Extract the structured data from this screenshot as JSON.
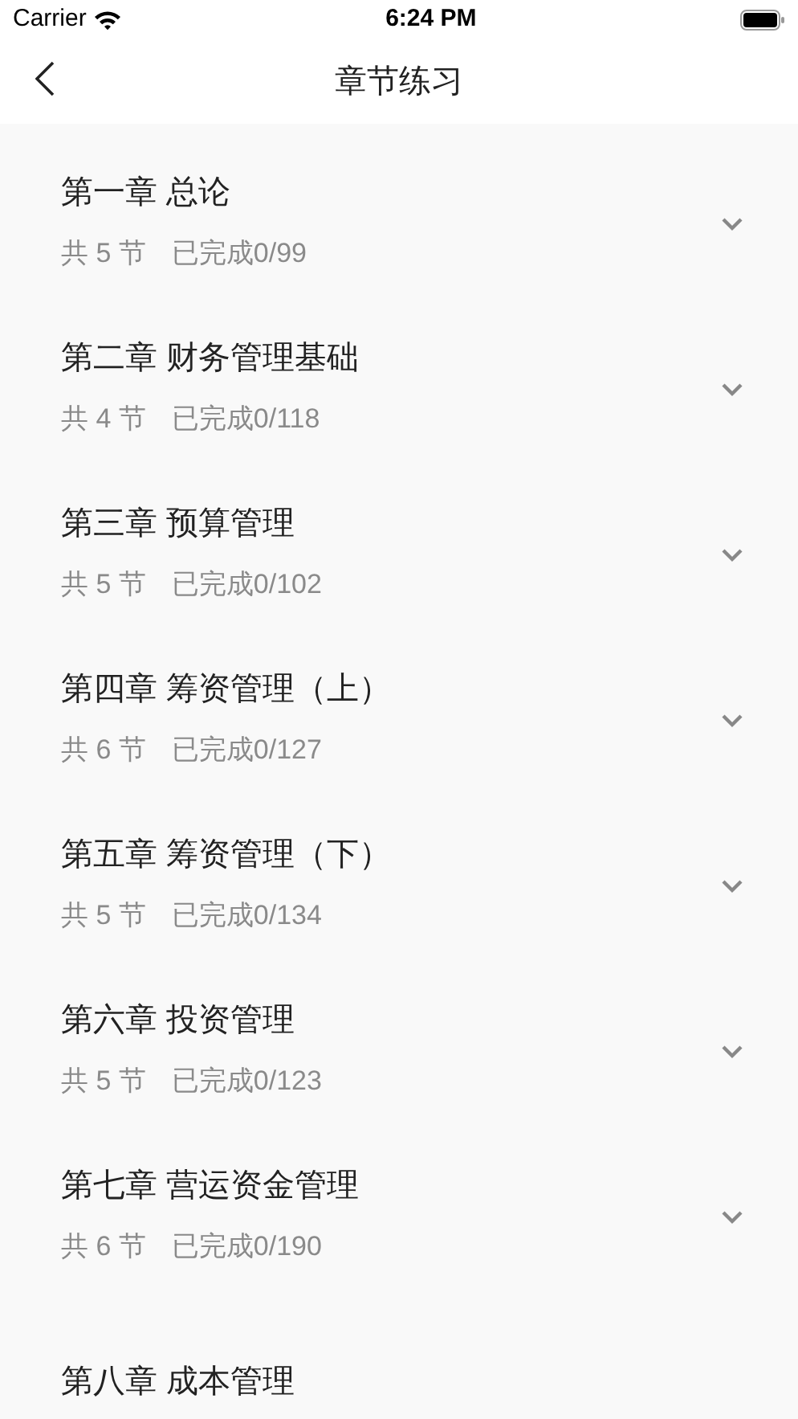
{
  "status_bar": {
    "carrier": "Carrier",
    "time": "6:24 PM"
  },
  "nav": {
    "title": "章节练习"
  },
  "chapters": [
    {
      "title": "第一章 总论",
      "sections": "共 5 节",
      "progress": "已完成0/99",
      "expanded": false
    },
    {
      "title": "第二章 财务管理基础",
      "sections": "共 4 节",
      "progress": "已完成0/118",
      "expanded": false
    },
    {
      "title": "第三章 预算管理",
      "sections": "共 5 节",
      "progress": "已完成0/102",
      "expanded": false
    },
    {
      "title": "第四章 筹资管理（上）",
      "sections": "共 6 节",
      "progress": "已完成0/127",
      "expanded": false
    },
    {
      "title": "第五章 筹资管理（下）",
      "sections": "共 5 节",
      "progress": "已完成0/134",
      "expanded": false
    },
    {
      "title": "第六章 投资管理",
      "sections": "共 5 节",
      "progress": "已完成0/123",
      "expanded": false
    },
    {
      "title": "第七章 营运资金管理",
      "sections": "共 6 节",
      "progress": "已完成0/190",
      "expanded": false
    },
    {
      "title": "第八章 成本管理"
    }
  ]
}
